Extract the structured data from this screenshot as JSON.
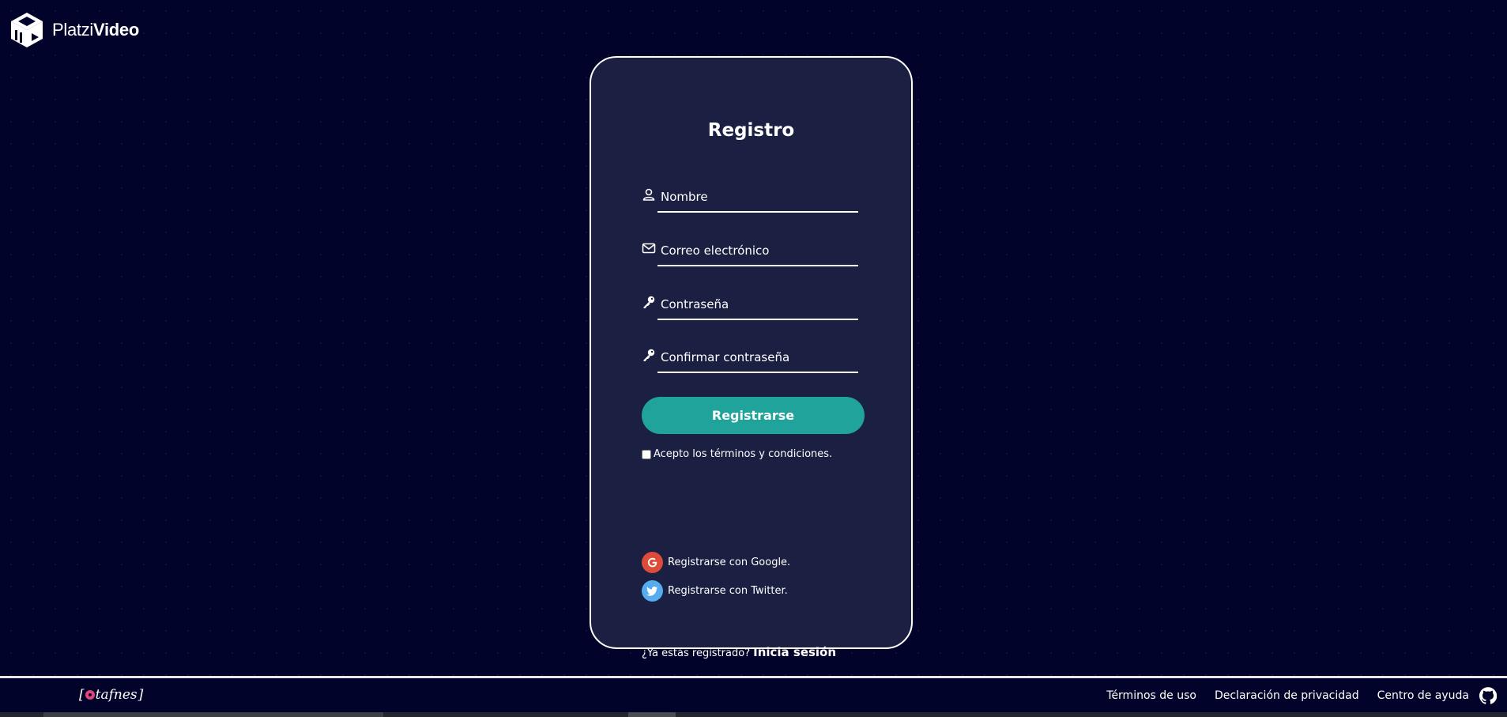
{
  "header": {
    "logo_light": "Platzi",
    "logo_bold": "Video",
    "logo_icon": "platzi-cube-icon"
  },
  "form": {
    "title": "Registro",
    "fields": [
      {
        "icon": "user-icon",
        "placeholder": "Nombre",
        "value": ""
      },
      {
        "icon": "envelope-icon",
        "placeholder": "Correo electrónico",
        "value": ""
      },
      {
        "icon": "key-icon",
        "placeholder": "Contraseña",
        "value": ""
      },
      {
        "icon": "key-icon",
        "placeholder": "Confirmar contraseña",
        "value": ""
      }
    ],
    "submit_label": "Registrarse",
    "terms_label": "Acepto los términos y condiciones.",
    "terms_checked": false,
    "google_label": "Registrarse con Google.",
    "twitter_label": "Registrarse con Twitter.",
    "login_prompt": "¿Ya estás registrado?",
    "login_link": "Inicia sesión"
  },
  "footer": {
    "brand": "tafnes",
    "links": [
      "Términos de uso",
      "Declaración de privacidad",
      "Centro de ayuda"
    ],
    "github_icon": "github-icon"
  },
  "colors": {
    "background": "#02032b",
    "card": "#1b1f41",
    "accent": "#20a39b",
    "google": "#dd4b39",
    "twitter": "#55acee"
  }
}
